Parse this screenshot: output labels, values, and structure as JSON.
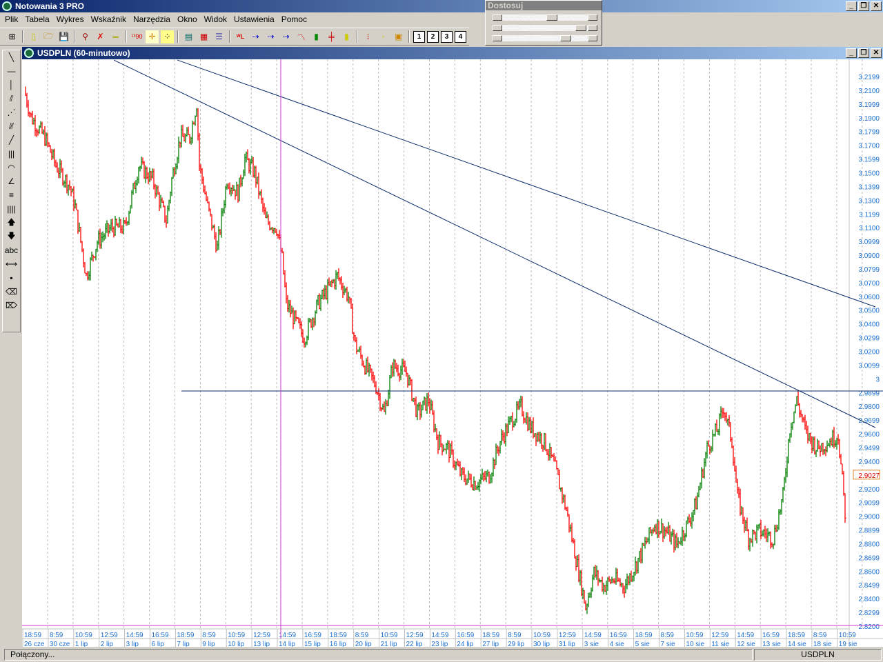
{
  "app": {
    "title": "Notowania 3 PRO"
  },
  "menu": [
    "Plik",
    "Tabela",
    "Wykres",
    "Wskaźnik",
    "Narzędzia",
    "Okno",
    "Widok",
    "Ustawienia",
    "Pomoc"
  ],
  "toolbar": {
    "layout_buttons": [
      "1",
      "2",
      "3",
      "4"
    ]
  },
  "panel": {
    "title": "Dostosuj",
    "sliders": [
      0.5,
      0.9,
      0.75
    ]
  },
  "chart_window": {
    "title": "USDPLN (60-minutowo)"
  },
  "palette": {
    "text_tool": "abc"
  },
  "status": {
    "connection": "Połączony...",
    "symbol": "USDPLN"
  },
  "colors": {
    "up": "#008000",
    "down": "#ff0000",
    "axis_text": "#1a6fd0",
    "trendline": "#0a2a6a",
    "marker": "#cc33cc"
  },
  "chart_data": {
    "type": "ohlc",
    "symbol": "USDPLN",
    "interval": "60-minutowo",
    "ylim": [
      2.82,
      3.2199
    ],
    "y_ticks": [
      "3.2199",
      "3.2100",
      "3.1999",
      "3.1900",
      "3.1799",
      "3.1700",
      "3.1599",
      "3.1500",
      "3.1399",
      "3.1300",
      "3.1199",
      "3.1100",
      "3.0999",
      "3.0900",
      "3.0799",
      "3.0700",
      "3.0600",
      "3.0500",
      "3.0400",
      "3.0299",
      "3.0200",
      "3.0099",
      "3",
      "2.9899",
      "2.9800",
      "2.9699",
      "2.9600",
      "2.9499",
      "2.9400",
      "2.9027",
      "2.9200",
      "2.9099",
      "2.9000",
      "2.8899",
      "2.8800",
      "2.8699",
      "2.8600",
      "2.8499",
      "2.8400",
      "2.8299",
      "2.8200"
    ],
    "last_price": "2.9027",
    "x_times": [
      "18:59",
      "8:59",
      "10:59",
      "12:59",
      "14:59",
      "16:59",
      "18:59",
      "8:59",
      "10:59",
      "12:59",
      "14:59",
      "16:59",
      "18:59",
      "8:59",
      "10:59",
      "12:59",
      "14:59",
      "16:59",
      "18:59",
      "8:59",
      "10:59",
      "12:59",
      "14:59",
      "16:59",
      "18:59",
      "8:59",
      "10:59",
      "12:59",
      "14:59",
      "16:59",
      "18:59",
      "8:59",
      "10:59"
    ],
    "x_dates": [
      "26 cze",
      "30 cze",
      "1 lip",
      "2 lip",
      "3 lip",
      "6 lip",
      "7 lip",
      "9 lip",
      "10 lip",
      "13 lip",
      "14 lip",
      "15 lip",
      "16 lip",
      "20 lip",
      "21 lip",
      "22 lip",
      "23 lip",
      "24 lip",
      "27 lip",
      "29 lip",
      "30 lip",
      "31 lip",
      "3 sie",
      "4 sie",
      "5 sie",
      "7 sie",
      "10 sie",
      "11 sie",
      "12 sie",
      "13 sie",
      "14 sie",
      "18 sie",
      "19 sie"
    ],
    "hours_total": 600,
    "price_path": [
      [
        1,
        3.2104
      ],
      [
        6,
        3.1903
      ],
      [
        16,
        3.1753
      ],
      [
        24,
        3.1552
      ],
      [
        34,
        3.1401
      ],
      [
        38,
        3.1251
      ],
      [
        46,
        3.0749
      ],
      [
        54,
        3.0998
      ],
      [
        64,
        3.11
      ],
      [
        74,
        3.11
      ],
      [
        84,
        3.1552
      ],
      [
        94,
        3.1451
      ],
      [
        104,
        3.115
      ],
      [
        108,
        3.1451
      ],
      [
        114,
        3.1753
      ],
      [
        121,
        3.1753
      ],
      [
        126,
        3.2003
      ],
      [
        128,
        3.1552
      ],
      [
        134,
        3.1251
      ],
      [
        141,
        3.095
      ],
      [
        148,
        3.1451
      ],
      [
        156,
        3.1351
      ],
      [
        161,
        3.1602
      ],
      [
        168,
        3.1501
      ],
      [
        176,
        3.115
      ],
      [
        184,
        3.11
      ],
      [
        188,
        3.0874
      ],
      [
        191,
        3.0548
      ],
      [
        196,
        3.0448
      ],
      [
        204,
        3.0297
      ],
      [
        214,
        3.0548
      ],
      [
        221,
        3.0648
      ],
      [
        228,
        3.0749
      ],
      [
        236,
        3.0598
      ],
      [
        241,
        3.0247
      ],
      [
        248,
        3.0096
      ],
      [
        256,
        2.9946
      ],
      [
        262,
        2.9745
      ],
      [
        268,
        3.0096
      ],
      [
        278,
        3.0046
      ],
      [
        286,
        2.9745
      ],
      [
        294,
        2.9846
      ],
      [
        301,
        2.9544
      ],
      [
        308,
        2.9494
      ],
      [
        318,
        2.9294
      ],
      [
        328,
        2.9243
      ],
      [
        338,
        2.9294
      ],
      [
        346,
        2.9544
      ],
      [
        354,
        2.9695
      ],
      [
        361,
        2.9795
      ],
      [
        368,
        2.9645
      ],
      [
        378,
        2.9544
      ],
      [
        386,
        2.9344
      ],
      [
        394,
        2.9043
      ],
      [
        401,
        2.8691
      ],
      [
        408,
        2.834
      ],
      [
        414,
        2.8591
      ],
      [
        421,
        2.8491
      ],
      [
        428,
        2.8541
      ],
      [
        436,
        2.8491
      ],
      [
        444,
        2.8641
      ],
      [
        451,
        2.8792
      ],
      [
        458,
        2.8943
      ],
      [
        466,
        2.8892
      ],
      [
        474,
        2.8792
      ],
      [
        484,
        2.8993
      ],
      [
        488,
        2.9093
      ],
      [
        496,
        2.9494
      ],
      [
        504,
        2.9645
      ],
      [
        508,
        2.9795
      ],
      [
        514,
        2.9544
      ],
      [
        518,
        2.9143
      ],
      [
        526,
        2.8842
      ],
      [
        534,
        2.8892
      ],
      [
        544,
        2.8842
      ],
      [
        551,
        2.9143
      ],
      [
        556,
        2.9645
      ],
      [
        561,
        2.9846
      ],
      [
        568,
        2.9595
      ],
      [
        576,
        2.9494
      ],
      [
        584,
        2.9544
      ],
      [
        591,
        2.9595
      ],
      [
        596,
        2.9027
      ]
    ],
    "trendlines": [
      {
        "t1": 66,
        "p1": 3.2319,
        "t2": 618,
        "p2": 2.9645
      },
      {
        "t1": 112,
        "p1": 3.2319,
        "t2": 618,
        "p2": 3.0523
      }
    ],
    "horizontal_line": {
      "price": 2.9911,
      "from_t": 115
    },
    "vertical_marker": {
      "t": 187
    }
  }
}
